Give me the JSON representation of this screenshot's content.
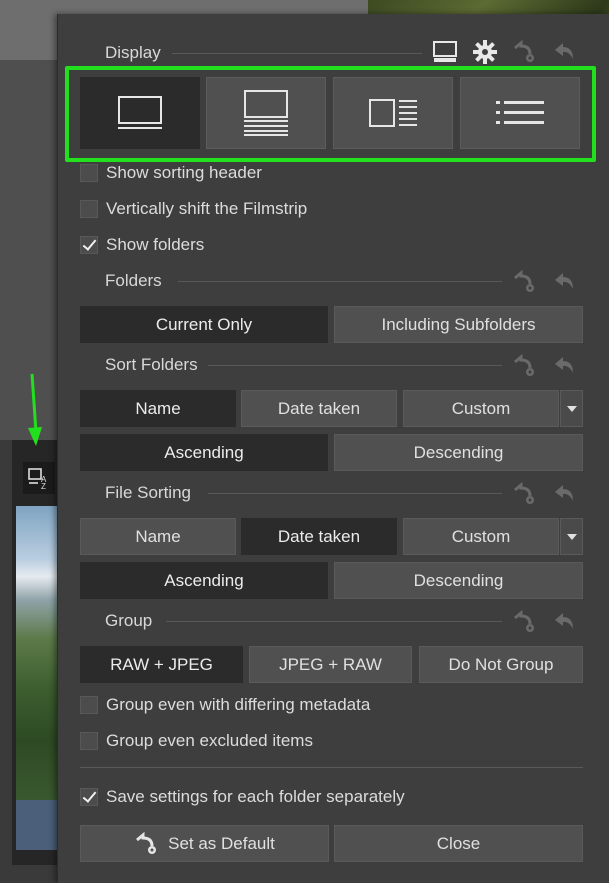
{
  "panel": {
    "display": {
      "title": "Display",
      "view_modes": [
        {
          "name": "thumbnails-view-icon",
          "selected": true
        },
        {
          "name": "thumbnails-details-view-icon",
          "selected": false
        },
        {
          "name": "split-view-icon",
          "selected": false
        },
        {
          "name": "list-view-icon",
          "selected": false
        }
      ]
    },
    "options": {
      "show_sorting_header": {
        "label": "Show sorting header",
        "checked": false
      },
      "vertical_shift": {
        "label": "Vertically shift the Filmstrip",
        "checked": false
      },
      "show_folders": {
        "label": "Show folders",
        "checked": true
      }
    },
    "folders": {
      "title": "Folders",
      "current_only": "Current Only",
      "including_subfolders": "Including Subfolders",
      "selected": "Current Only"
    },
    "sort_folders": {
      "title": "Sort Folders",
      "name": "Name",
      "date_taken": "Date taken",
      "custom": "Custom",
      "ascending": "Ascending",
      "descending": "Descending",
      "selected_field": "Name",
      "selected_order": "Ascending"
    },
    "file_sorting": {
      "title": "File Sorting",
      "name": "Name",
      "date_taken": "Date taken",
      "custom": "Custom",
      "ascending": "Ascending",
      "descending": "Descending",
      "selected_field": "Date taken",
      "selected_order": "Ascending"
    },
    "group": {
      "title": "Group",
      "raw_jpeg": "RAW + JPEG",
      "jpeg_raw": "JPEG + RAW",
      "do_not_group": "Do Not Group",
      "selected": "RAW + JPEG",
      "differing_metadata": {
        "label": "Group even with differing metadata",
        "checked": false
      },
      "excluded_items": {
        "label": "Group even excluded items",
        "checked": false
      }
    },
    "save_separately": {
      "label": "Save settings for each folder separately",
      "checked": true
    },
    "footer": {
      "set_default": "Set as Default",
      "close": "Close"
    }
  },
  "colors": {
    "highlight": "#22e01e",
    "arrow": "#22e01e",
    "selected_button": "#2b2b2b",
    "button": "#505050"
  }
}
